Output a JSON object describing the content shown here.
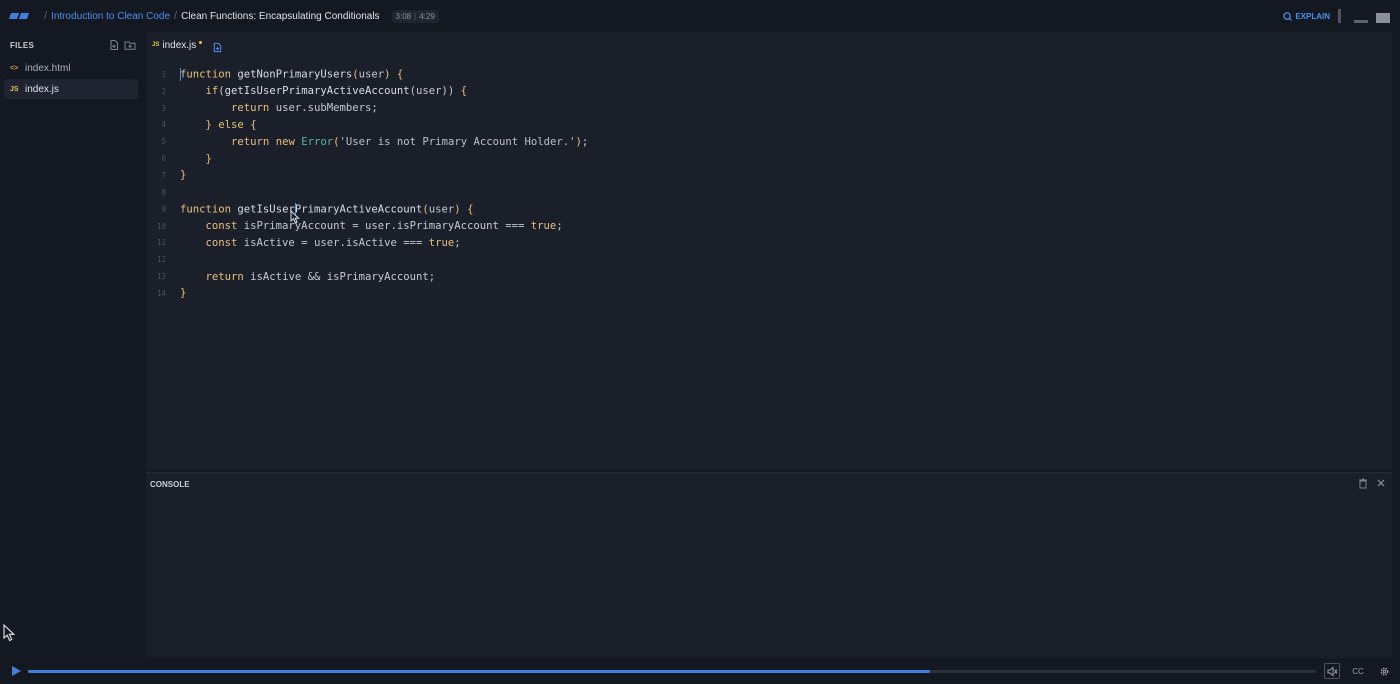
{
  "header": {
    "breadcrumb_separator": "/",
    "course_link": "Introduction to Clean Code",
    "lesson_title": "Clean Functions: Encapsulating Conditionals",
    "time_current": "3:08",
    "time_total": "4:29",
    "explain_label": "EXPLAIN",
    "accent_color": "#3f7fe0"
  },
  "sidebar": {
    "title": "FILES",
    "files": [
      {
        "icon": "<>",
        "name": "index.html",
        "active": false
      },
      {
        "icon": "JS",
        "name": "index.js",
        "active": true
      }
    ]
  },
  "editor": {
    "tab_icon": "JS",
    "tab_name": "index.js",
    "unsaved": true,
    "lines": [
      {
        "n": "1"
      },
      {
        "n": "2"
      },
      {
        "n": "3"
      },
      {
        "n": "4"
      },
      {
        "n": "5"
      },
      {
        "n": "6"
      },
      {
        "n": "7"
      },
      {
        "n": "8"
      },
      {
        "n": "9"
      },
      {
        "n": "10"
      },
      {
        "n": "11"
      },
      {
        "n": "12"
      },
      {
        "n": "13"
      },
      {
        "n": "14"
      }
    ]
  },
  "console": {
    "title": "CONSOLE",
    "clear_icon": "trash-icon",
    "close_icon": "close-icon"
  },
  "player": {
    "progress": 0.7,
    "cc_label": "CC"
  }
}
